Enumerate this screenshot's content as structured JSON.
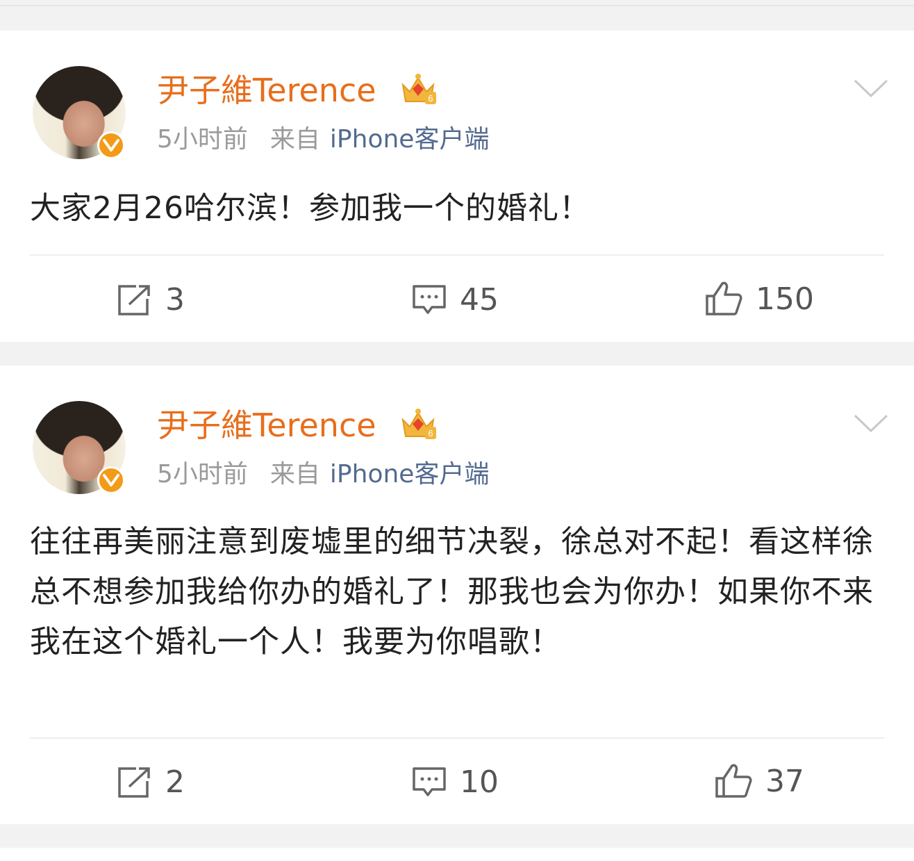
{
  "posts": [
    {
      "username": "尹子維Terence",
      "time": "5小时前",
      "from_label": "来自",
      "client": "iPhone客户端",
      "text": "大家2月26哈尔滨！参加我一个的婚礼！",
      "repost_count": "3",
      "comment_count": "45",
      "like_count": "150"
    },
    {
      "username": "尹子維Terence",
      "time": "5小时前",
      "from_label": "来自",
      "client": "iPhone客户端",
      "text": "往往再美丽注意到废墟里的细节决裂，徐总对不起！看这样徐总不想参加我给你办的婚礼了！那我也会为你办！如果你不来我在这个婚礼一个人！我要为你唱歌！",
      "repost_count": "2",
      "comment_count": "10",
      "like_count": "37"
    }
  ],
  "colors": {
    "username": "#e86e1c",
    "client_link": "#536a8f",
    "meta_gray": "#9a9a9a",
    "badge": "#f39a17",
    "background": "#f2f2f2"
  },
  "icons": [
    "verified-badge-icon",
    "crown-level-icon",
    "chevron-down-icon",
    "repost-icon",
    "comment-icon",
    "like-icon"
  ]
}
